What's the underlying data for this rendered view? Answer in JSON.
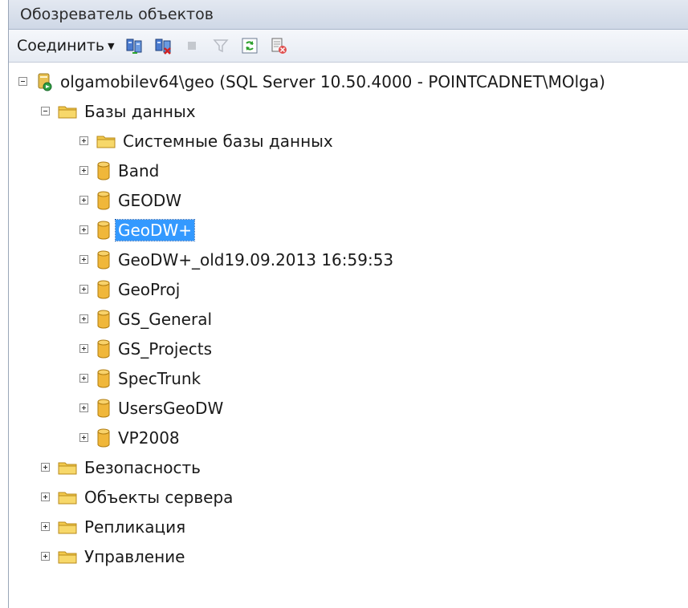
{
  "panel": {
    "title": "Обозреватель объектов"
  },
  "toolbar": {
    "connect_label": "Соединить",
    "buttons": [
      {
        "icon": "connect-server-icon"
      },
      {
        "icon": "disconnect-server-icon"
      },
      {
        "icon": "stop-icon"
      },
      {
        "icon": "filter-icon"
      },
      {
        "icon": "refresh-icon"
      },
      {
        "icon": "script-icon"
      }
    ]
  },
  "tree": {
    "server": "olgamobilev64\\geo (SQL Server 10.50.4000 - POINTCADNET\\MOlga)",
    "databases_folder": "Базы данных",
    "system_databases": "Системные базы данных",
    "databases": [
      "Band",
      "GEODW",
      "GeoDW+",
      "GeoDW+_old19.09.2013 16:59:53",
      "GeoProj",
      "GS_General",
      "GS_Projects",
      "SpecTrunk",
      "UsersGeoDW",
      "VP2008"
    ],
    "selected": "GeoDW+",
    "folders": [
      "Безопасность",
      "Объекты сервера",
      "Репликация",
      "Управление"
    ]
  },
  "colors": {
    "selection": "#3399ff",
    "folder": "#f2c94c",
    "database": "#f0b73a"
  }
}
